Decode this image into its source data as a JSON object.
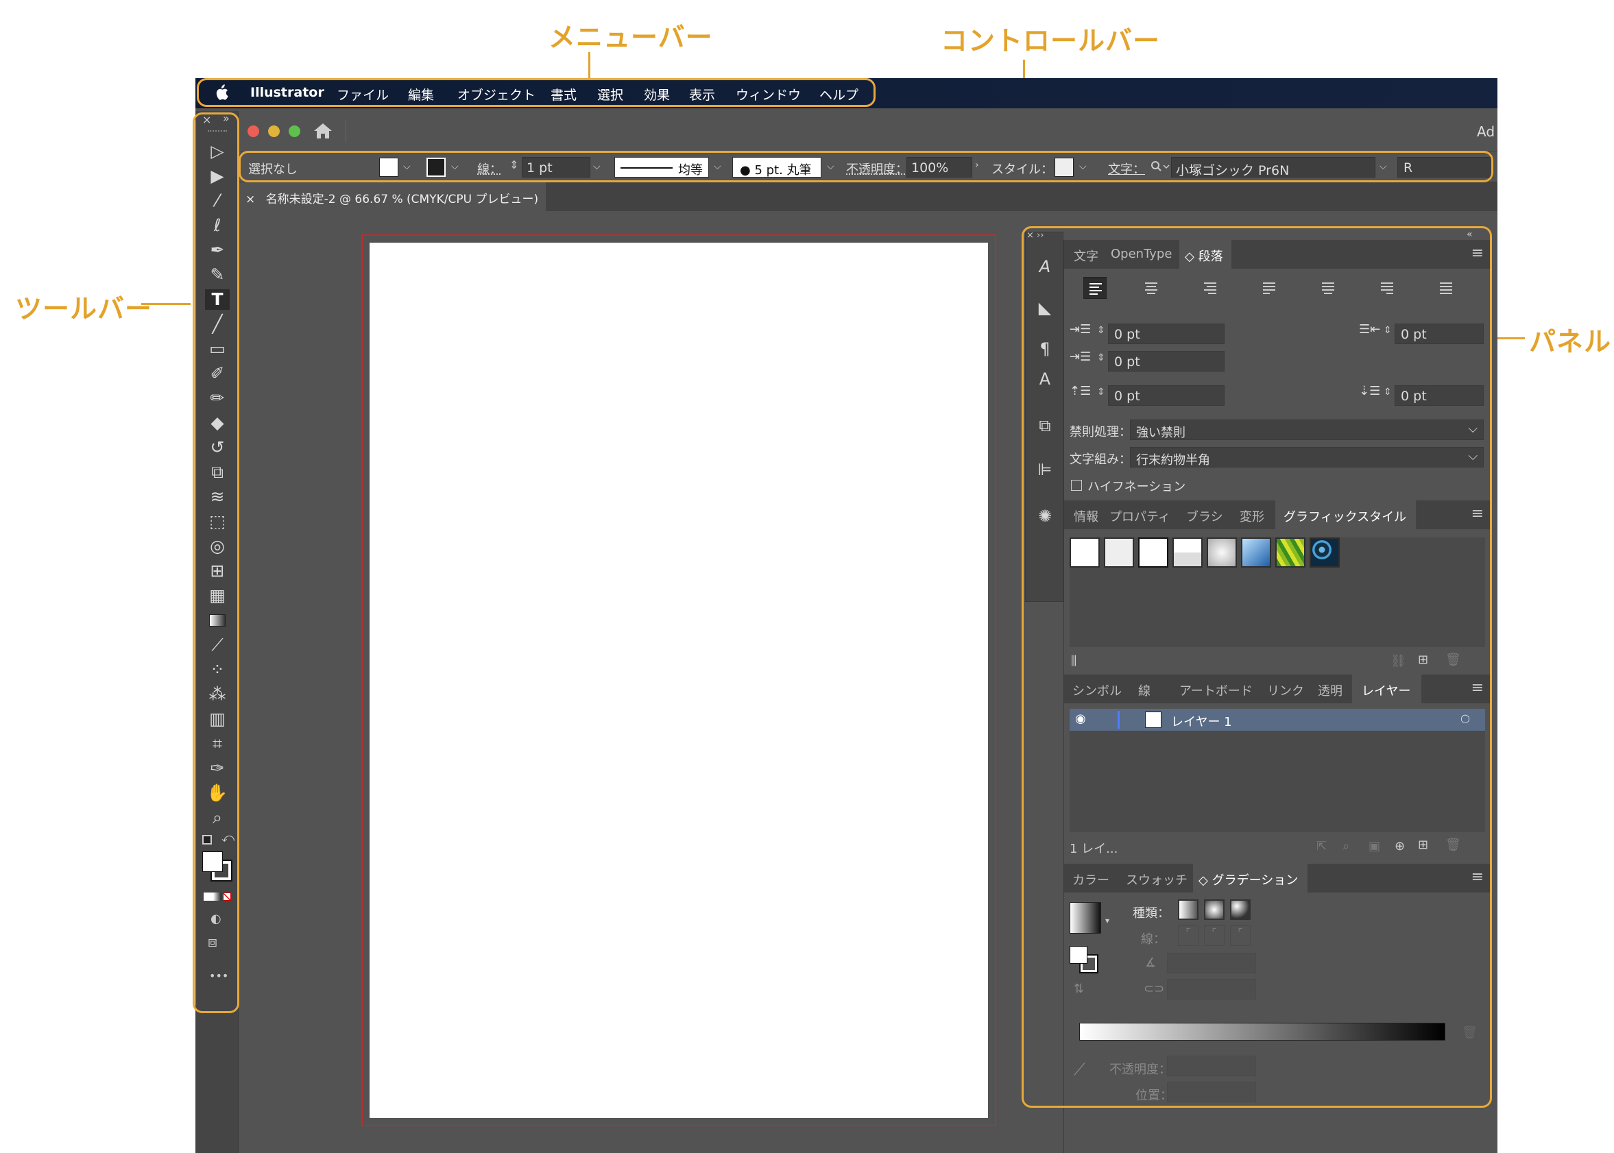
{
  "annotations": {
    "menubar": "メニューバー",
    "controlbar": "コントロールバー",
    "toolbar": "ツールバー",
    "panel": "パネル"
  },
  "colors": {
    "annotation": "#e3a32b",
    "menubar_bg": "#0e1b33",
    "ui_bg": "#535353",
    "artboard_border": "#c62828"
  },
  "menubar": {
    "apple_icon": "apple-icon",
    "app_name": "Illustrator",
    "items": [
      "ファイル",
      "編集",
      "オブジェクト",
      "書式",
      "選択",
      "効果",
      "表示",
      "ウィンドウ",
      "ヘルプ"
    ]
  },
  "window": {
    "home_icon": "home-icon",
    "app_label_partial": "Ad"
  },
  "controlbar": {
    "selection": "選択なし",
    "stroke_label": "線：",
    "stroke_weight": "1 pt",
    "stroke_profile": "均等",
    "brush": "5 pt. 丸筆",
    "opacity_label": "不透明度：",
    "opacity_value": "100%",
    "style_label": "スタイル：",
    "char_label": "文字：",
    "font_family": "小塚ゴシック Pr6N",
    "font_style": "R"
  },
  "document": {
    "tab_close": "×",
    "tab_title": "名称未設定-2 @ 66.67 % (CMYK/CPU プレビュー)"
  },
  "toolbar": {
    "header_close": "×",
    "header_expand": "»",
    "more_label": "•••"
  },
  "panels": {
    "collapse_label": "«",
    "char_group": {
      "tabs": [
        "文字",
        "OpenType",
        "段落"
      ],
      "active_tab": "段落",
      "indent_fields": [
        "0 pt",
        "0 pt",
        "0 pt",
        "0 pt",
        "0 pt"
      ],
      "kinsoku_label": "禁則処理：",
      "kinsoku_value": "強い禁則",
      "mojikumi_label": "文字組み：",
      "mojikumi_value": "行末約物半角",
      "hyphenation_label": "ハイフネーション"
    },
    "style_group": {
      "tabs": [
        "情報",
        "プロパティ",
        "ブラシ",
        "変形",
        "グラフィックスタイル"
      ],
      "active_tab": "グラフィックスタイル"
    },
    "layer_group": {
      "tabs": [
        "シンボル",
        "線",
        "アートボード",
        "リンク",
        "透明",
        "レイヤー"
      ],
      "active_tab": "レイヤー",
      "layers": [
        {
          "name": "レイヤー 1"
        }
      ],
      "footer_count": "1 レイ..."
    },
    "gradient_group": {
      "tabs": [
        "カラー",
        "スウォッチ",
        "グラデーション"
      ],
      "active_tab": "グラデーション",
      "type_label": "種類：",
      "stroke_label": "線：",
      "opacity_label": "不透明度：",
      "position_label": "位置："
    }
  }
}
